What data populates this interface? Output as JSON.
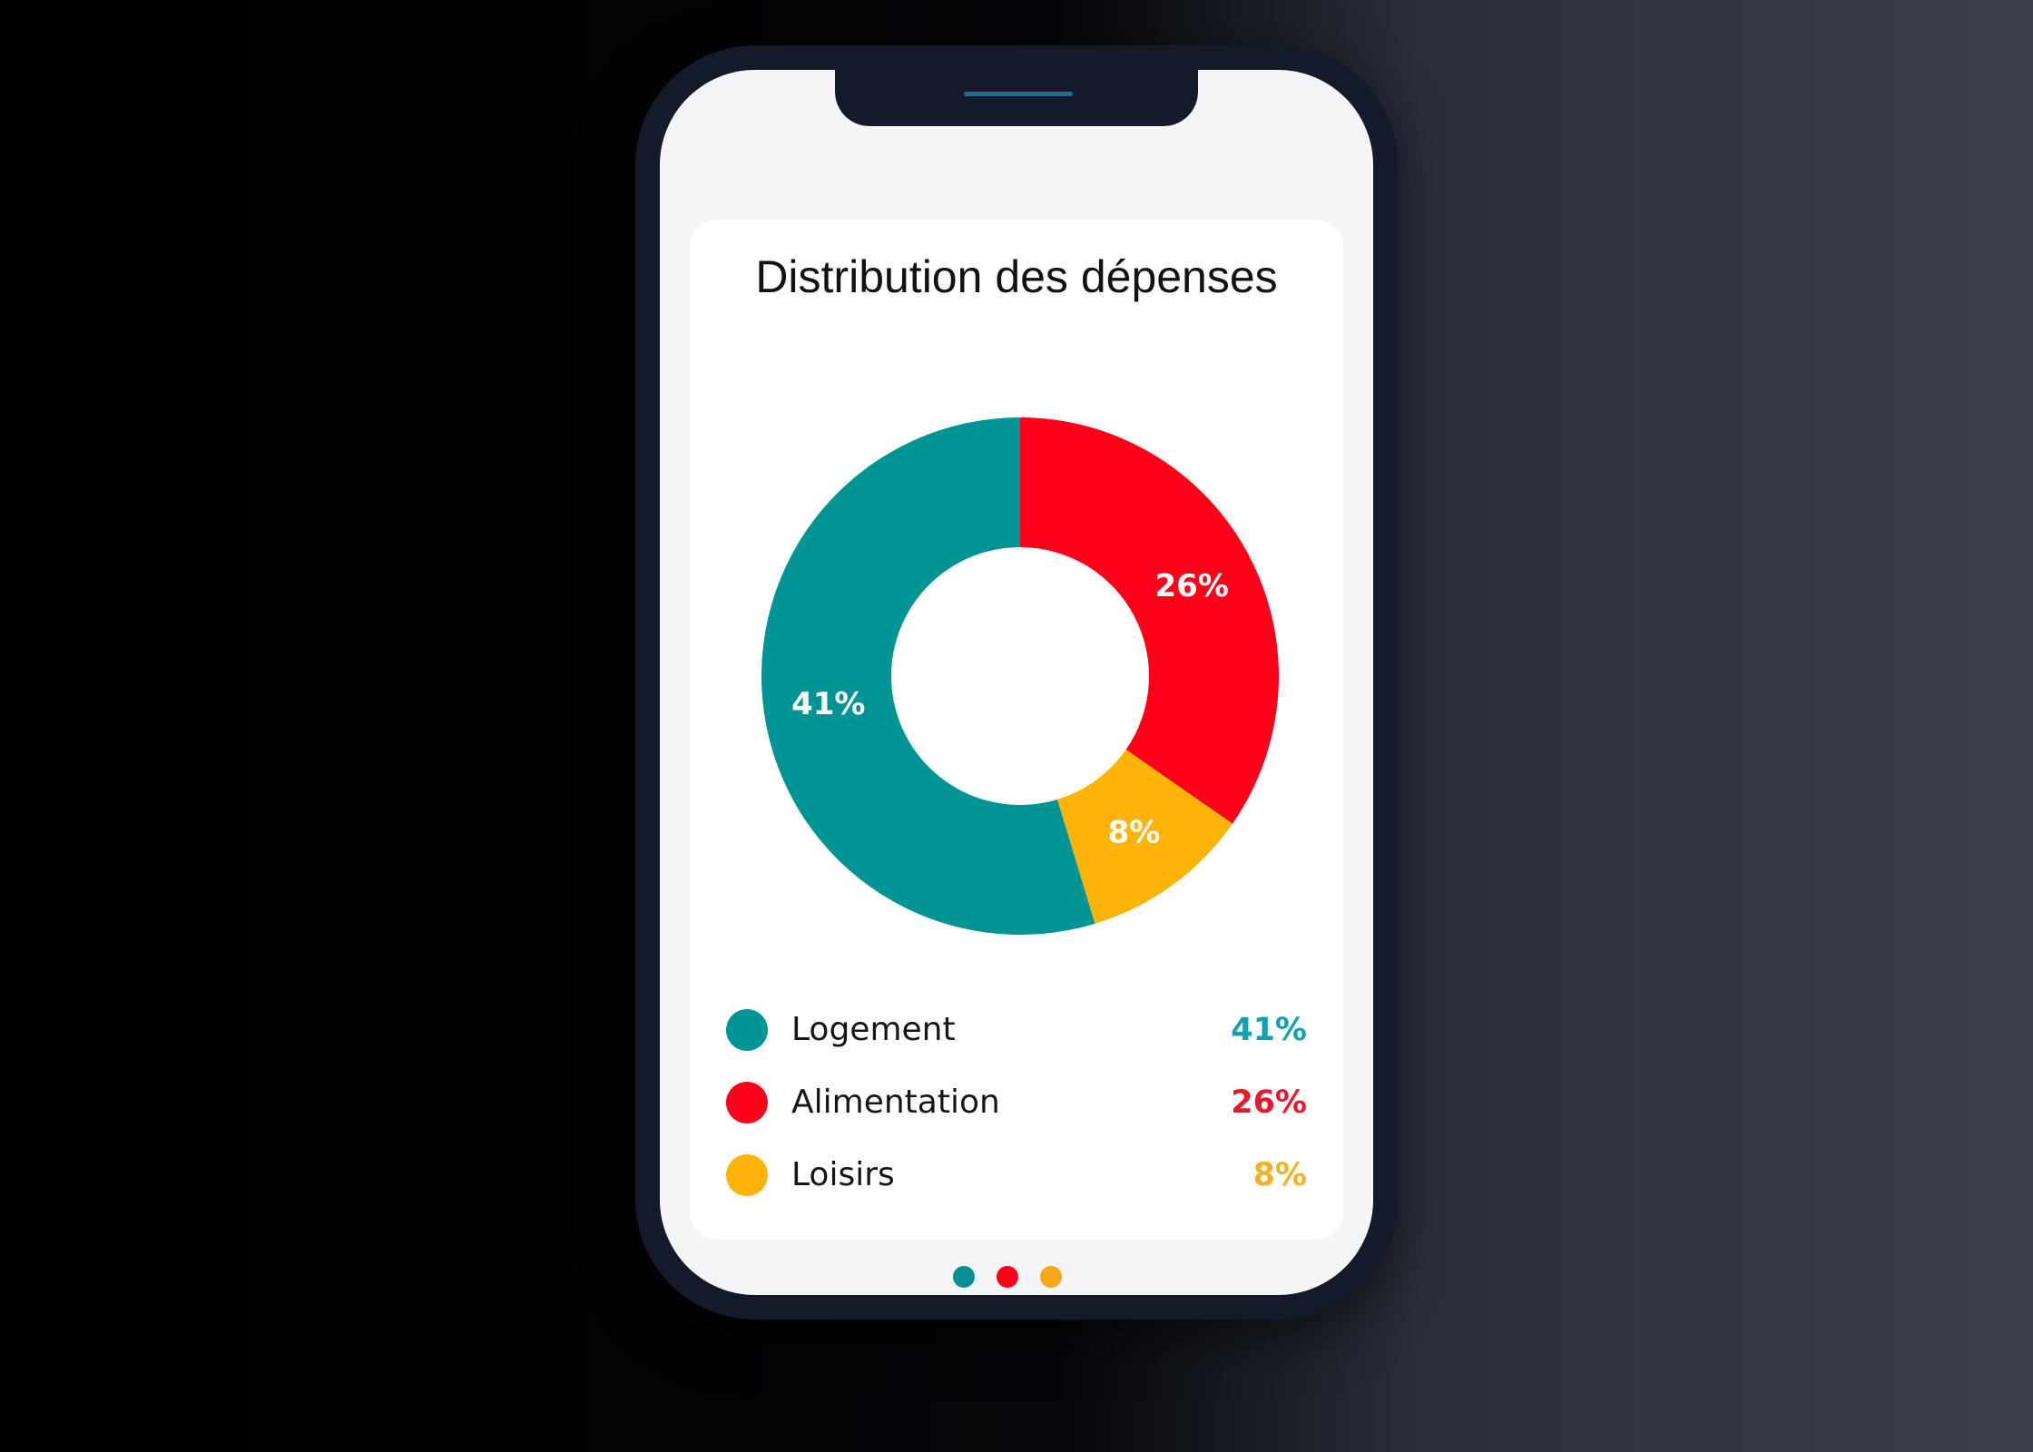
{
  "chart_data": {
    "type": "pie",
    "donut": true,
    "title": "Distribution des dépenses",
    "categories": [
      "Logement",
      "Alimentation",
      "Loisirs"
    ],
    "values": [
      41,
      26,
      8
    ],
    "value_labels": [
      "41%",
      "26%",
      "8%"
    ],
    "colors": [
      "#009495",
      "#fe0019",
      "#fdb308"
    ],
    "legend": "bottom"
  },
  "legend": {
    "items": [
      {
        "label": "Logement",
        "value": "41%",
        "color": "#009495",
        "value_color": "#10a2b3"
      },
      {
        "label": "Alimentation",
        "value": "26%",
        "color": "#fe0019",
        "value_color": "#e8192c"
      },
      {
        "label": "Loisirs",
        "value": "8%",
        "color": "#fdb308",
        "value_color": "#f2b227"
      }
    ]
  },
  "pager": {
    "dots": [
      {
        "color": "#0a8f95",
        "active": true
      },
      {
        "color": "#fe0019",
        "active": false
      },
      {
        "color": "#f6a81a",
        "active": false
      }
    ]
  }
}
